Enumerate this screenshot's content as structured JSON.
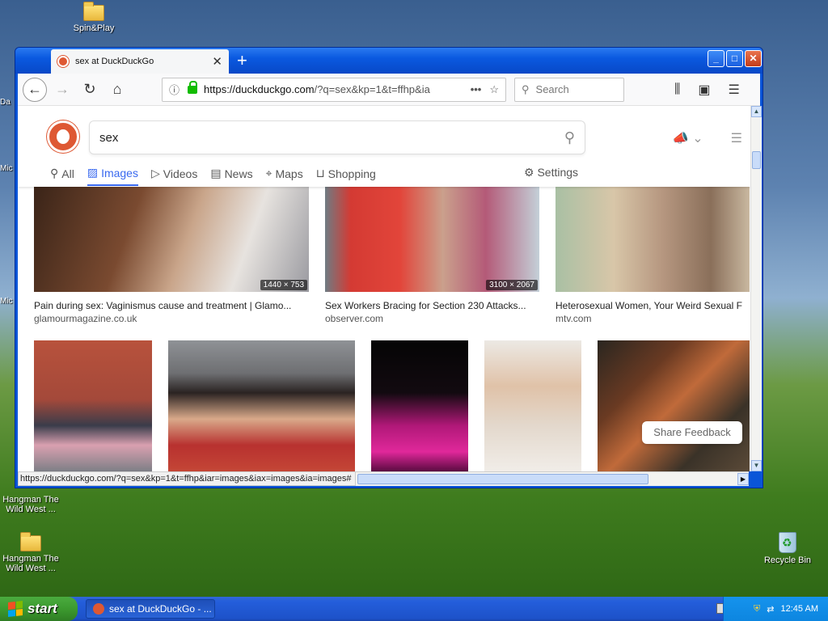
{
  "desktop": {
    "icons": [
      {
        "label": "Spin&Play"
      },
      {
        "label": "Hangman The Wild West ..."
      },
      {
        "label": "Hangman The Wild West ..."
      },
      {
        "label": "Recycle Bin"
      }
    ],
    "edge_labels": [
      "Da",
      "Mic",
      "Mic"
    ]
  },
  "browser": {
    "tab_title": "sex at DuckDuckGo",
    "url_host": "https://duckduckgo.com",
    "url_path": "/?q=sex&kp=1&t=ffhp&ia",
    "search_placeholder": "Search",
    "status_url": "https://duckduckgo.com/?q=sex&kp=1&t=ffhp&iar=images&iax=images&ia=images#"
  },
  "ddg": {
    "query": "sex",
    "tabs": [
      {
        "label": "All",
        "icon": "search-icon"
      },
      {
        "label": "Images",
        "icon": "image-icon",
        "active": true
      },
      {
        "label": "Videos",
        "icon": "play-icon"
      },
      {
        "label": "News",
        "icon": "newspaper-icon"
      },
      {
        "label": "Maps",
        "icon": "map-pin-icon"
      },
      {
        "label": "Shopping",
        "icon": "bag-icon"
      }
    ],
    "settings_label": "Settings",
    "feedback_label": "Share Feedback",
    "results_row1": [
      {
        "title": "Pain during sex: Vaginismus cause and treatment | Glamo...",
        "domain": "glamourmagazine.co.uk",
        "dims": "1440 × 753"
      },
      {
        "title": "Sex Workers Bracing for Section 230 Attacks...",
        "domain": "observer.com",
        "dims": "3100 × 2067"
      },
      {
        "title": "Heterosexual Women, Your Weird Sexual F",
        "domain": "mtv.com",
        "dims": ""
      }
    ]
  },
  "taskbar": {
    "start_label": "start",
    "task_label": "sex at DuckDuckGo - ...",
    "clock": "12:45 AM"
  },
  "colors": {
    "ddg_orange": "#de5833",
    "ddg_blue": "#3969ef",
    "xp_blue": "#0a55d8",
    "start_green": "#3c9a2f"
  }
}
